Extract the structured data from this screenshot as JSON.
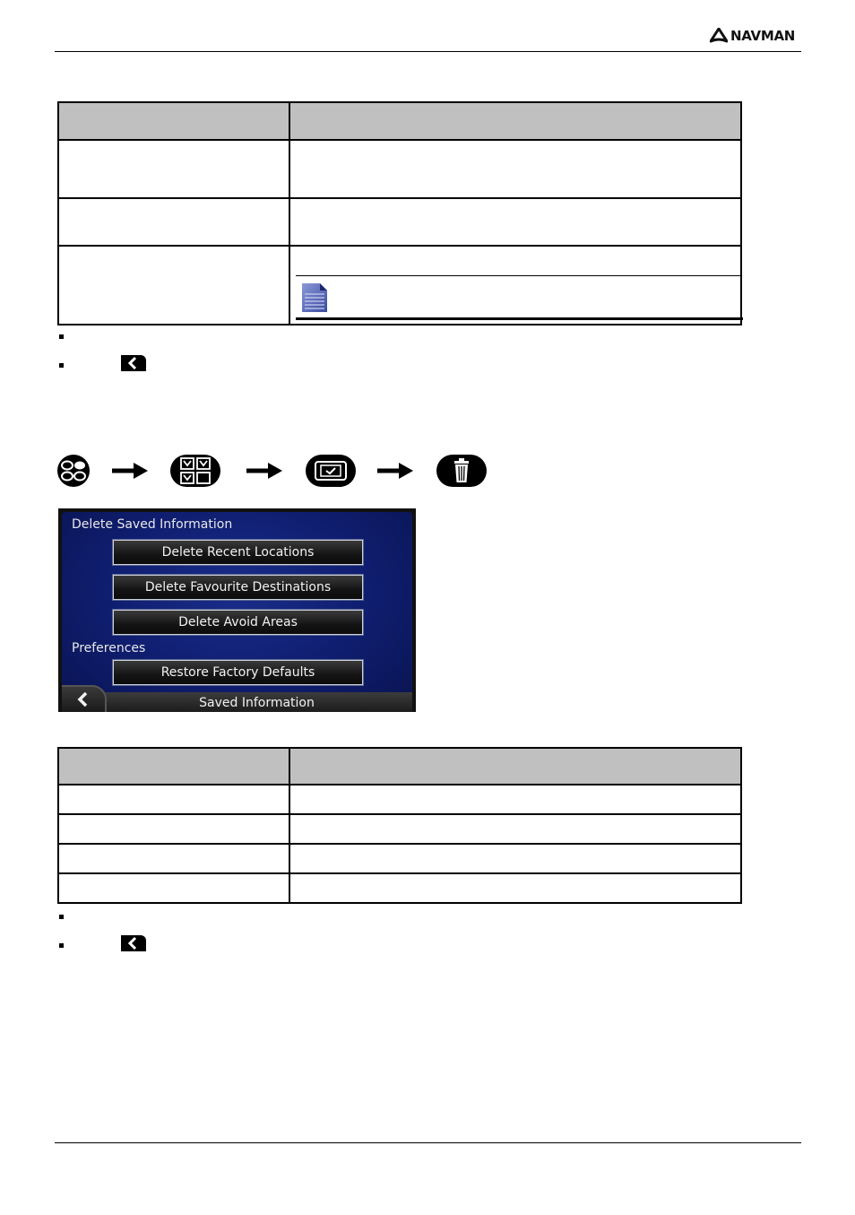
{
  "header": {
    "brand": "NAVMAN"
  },
  "table1": {
    "header": [
      "",
      ""
    ],
    "rows": [
      [
        "",
        ""
      ],
      [
        "",
        ""
      ],
      [
        "",
        ""
      ]
    ],
    "note_icon": "note-document-icon"
  },
  "bullets1": {
    "back_icon": "back-arrow-icon"
  },
  "flow": {
    "steps": [
      "main-menu-icon",
      "settings-icon",
      "saved-information-icon",
      "delete-icon"
    ],
    "arrow_icon": "right-arrow-icon"
  },
  "device_screen": {
    "section1_label": "Delete Saved Information",
    "buttons": [
      "Delete Recent Locations",
      "Delete Favourite Destinations",
      "Delete Avoid Areas"
    ],
    "section2_label": "Preferences",
    "preferences_button": "Restore Factory Defaults",
    "title": "Saved Information",
    "colors": {
      "background": "#0f1d6e",
      "button": "#141414",
      "text": "#f2f2f2"
    }
  },
  "table2": {
    "header": [
      "",
      ""
    ],
    "rows": [
      [
        "",
        ""
      ],
      [
        "",
        ""
      ],
      [
        "",
        ""
      ],
      [
        "",
        ""
      ]
    ]
  },
  "bullets2": {
    "back_icon": "back-arrow-icon"
  }
}
